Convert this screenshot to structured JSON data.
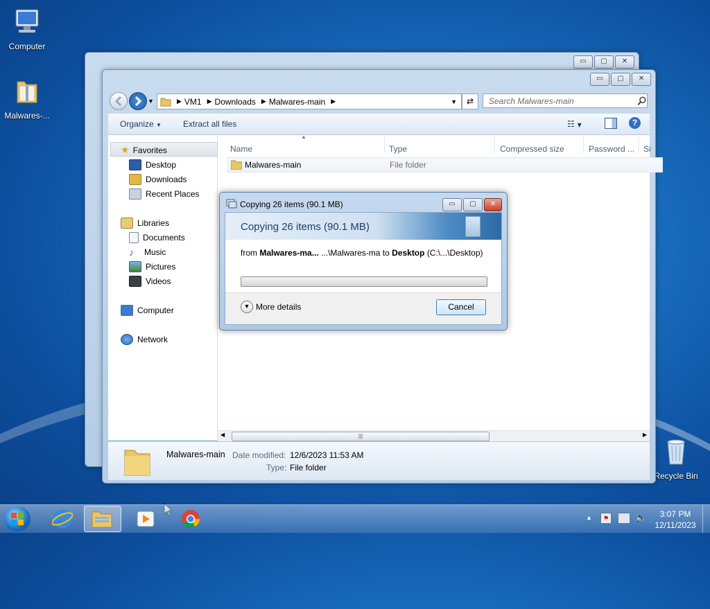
{
  "desktop": {
    "icons": [
      {
        "label": "Computer"
      },
      {
        "label": "Malwares-..."
      },
      {
        "label": "Recycle Bin"
      }
    ]
  },
  "explorer": {
    "caption_buttons": {
      "minimize": "▭",
      "maximize": "▢",
      "close": "✕"
    },
    "breadcrumb": [
      "VM1",
      "Downloads",
      "Malwares-main"
    ],
    "search_placeholder": "Search Malwares-main",
    "toolbar": {
      "organize": "Organize",
      "extract_all": "Extract all files"
    },
    "nav": {
      "favorites": "Favorites",
      "desktop": "Desktop",
      "downloads": "Downloads",
      "recent_places": "Recent Places",
      "libraries": "Libraries",
      "documents": "Documents",
      "music": "Music",
      "pictures": "Pictures",
      "videos": "Videos",
      "computer": "Computer",
      "network": "Network"
    },
    "columns": {
      "name": "Name",
      "type": "Type",
      "compressed_size": "Compressed size",
      "password": "Password ...",
      "size": "Si"
    },
    "rows": [
      {
        "name": "Malwares-main",
        "type": "File folder"
      }
    ],
    "details": {
      "name": "Malwares-main",
      "date_modified_label": "Date modified:",
      "date_modified_value": "12/6/2023 11:53 AM",
      "type_label": "Type:",
      "type_value": "File folder"
    }
  },
  "copy_dialog": {
    "window_title": "Copying 26 items (90.1 MB)",
    "heading": "Copying 26 items (90.1 MB)",
    "from_label": "from",
    "source": "Malwares-ma...",
    "source_path": "...\\Malwares-ma",
    "to_label": "to",
    "destination": "Desktop",
    "destination_path": "(C:\\...\\Desktop)",
    "progress": 0.0,
    "more_details": "More details",
    "cancel": "Cancel"
  },
  "taskbar": {
    "time": "3:07 PM",
    "date": "12/11/2023",
    "show_hidden": "▲"
  }
}
